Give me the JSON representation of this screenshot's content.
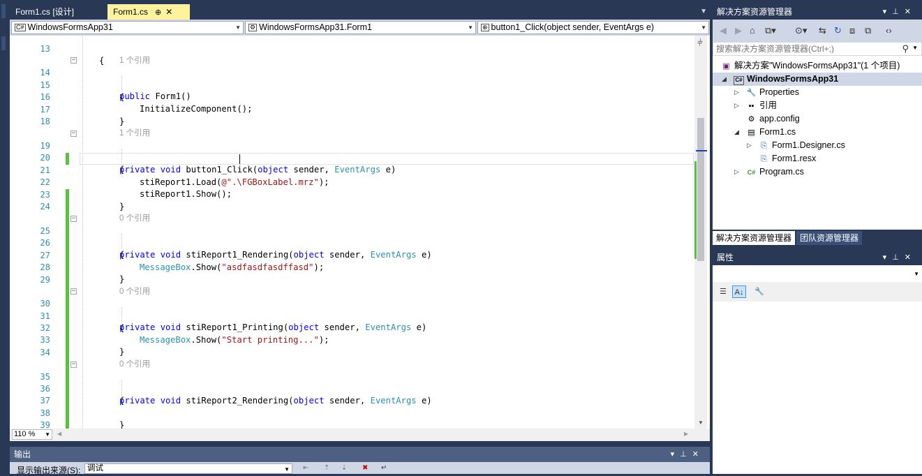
{
  "editor": {
    "tabs": [
      {
        "label": "Form1.cs [设计]"
      },
      {
        "label": "Form1.cs",
        "pin": "⊕",
        "close": "✕"
      }
    ],
    "nav": {
      "project": "WindowsFormsApp31",
      "class": "WindowsFormsApp31.Form1",
      "member": "button1_Click(object sender, EventArgs e)"
    },
    "zoom": "110 %",
    "ref1": "1 个引用",
    "ref0": "0 个引用",
    "lines": {
      "n13": "13",
      "n14": "14",
      "n15": "15",
      "n16": "16",
      "n17": "17",
      "n18": "18",
      "n19": "19",
      "n20": "20",
      "n21": "21",
      "n22": "22",
      "n23": "23",
      "n24": "24",
      "n25": "25",
      "n26": "26",
      "n27": "27",
      "n28": "28",
      "n29": "29",
      "n30": "30",
      "n31": "31",
      "n32": "32",
      "n33": "33",
      "n34": "34",
      "n35": "35",
      "n36": "36",
      "n37": "37",
      "n38": "38",
      "n39": "39"
    },
    "code": {
      "public": "public",
      "private": "private",
      "void": "void",
      "object": "object",
      "EventArgs": "EventArgs",
      "MessageBox": "MessageBox",
      "ctor": "Form1()",
      "init": "InitializeComponent();",
      "brace_open": "{",
      "brace_close": "}",
      "button1_click": "button1_Click(",
      "sender": "sender,",
      "e_close": "e)",
      "load_pre": "stiReport1.Load(",
      "load_str": "@\".\\FGBoxLabel.mrz\"",
      "load_post": ");",
      "show": "stiReport1.Show();",
      "rendering1": "stiReport1_Rendering(",
      "printing1": "stiReport1_Printing(",
      "rendering2": "stiReport2_Rendering(",
      "show_call": ".Show(",
      "str1": "\"asdfasdfasdffasd\"",
      "str2": "\"Start printing...\"",
      "end_call": ");"
    }
  },
  "output": {
    "title": "输出",
    "source_label": "显示输出来源(S):",
    "source_value": "调试"
  },
  "solution_explorer": {
    "title": "解决方案资源管理器",
    "search_placeholder": "搜索解决方案资源管理器(Ctrl+;)",
    "tree": [
      {
        "label": "解决方案\"WindowsFormsApp31\"(1 个项目)"
      },
      {
        "label": "WindowsFormsApp31"
      },
      {
        "label": "Properties"
      },
      {
        "label": "引用"
      },
      {
        "label": "app.config"
      },
      {
        "label": "Form1.cs"
      },
      {
        "label": "Form1.Designer.cs"
      },
      {
        "label": "Form1.resx"
      },
      {
        "label": "Program.cs"
      }
    ],
    "tabs": [
      "解决方案资源管理器",
      "团队资源管理器"
    ]
  },
  "properties": {
    "title": "属性"
  },
  "colors": {
    "chrome": "#293955",
    "active_tab": "#fff29d",
    "keyword": "#0000ff",
    "type": "#2b91af",
    "string": "#a31515",
    "change_bar": "#57c240"
  }
}
